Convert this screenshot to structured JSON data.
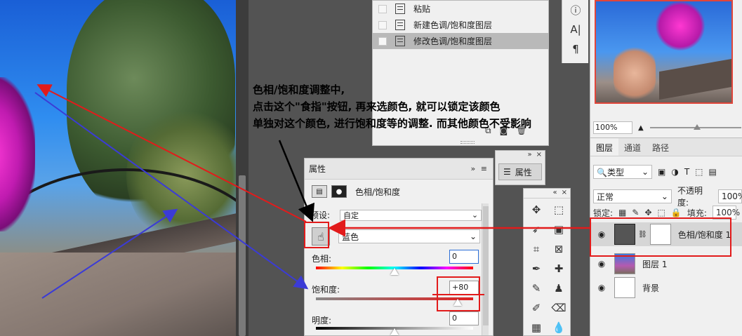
{
  "history": {
    "items": [
      {
        "label": "粘贴",
        "selected": false
      },
      {
        "label": "新建色调/饱和度图层",
        "selected": false
      },
      {
        "label": "修改色调/饱和度图层",
        "selected": true
      }
    ]
  },
  "annotation": {
    "line1": "色相/饱和度调整中,",
    "line2": "点击这个\"食指\"按钮, 再来选颜色, 就可以锁定该颜色",
    "line3": "单独对这个颜色, 进行饱和度等的调整. 而其他颜色不受影响"
  },
  "side_tools": {
    "info": "ⓘ",
    "char": "A|",
    "para": "¶"
  },
  "navigator": {
    "zoom": "100%"
  },
  "layers_panel": {
    "tabs": [
      "图层",
      "通道",
      "路径"
    ],
    "filter_label": "类型",
    "blend_mode": "正常",
    "opacity_label": "不透明度:",
    "opacity_value": "100%",
    "lock_label": "锁定:",
    "fill_label": "填充:",
    "fill_value": "100%",
    "layers": [
      {
        "name": "色相/饱和度 1",
        "selected": true
      },
      {
        "name": "图层 1",
        "selected": false
      },
      {
        "name": "背景",
        "selected": false
      }
    ]
  },
  "props_mini": {
    "label": "属性",
    "collapse": "»",
    "close": "×"
  },
  "toolbox": {
    "collapse": "«",
    "close": "×"
  },
  "properties": {
    "tab": "属性",
    "controls": "»  ≡",
    "title": "色相/饱和度",
    "preset_label": "预设:",
    "preset_value": "自定",
    "channel_value": "蓝色",
    "hue_label": "色相:",
    "hue_value": "0",
    "saturation_label": "饱和度:",
    "saturation_value": "+80",
    "lightness_label": "明度:",
    "lightness_value": "0"
  },
  "colors": {
    "highlight": "#e21b1b",
    "arrow_blue": "#3b3bd6",
    "panel_bg": "#f0f0f0"
  }
}
